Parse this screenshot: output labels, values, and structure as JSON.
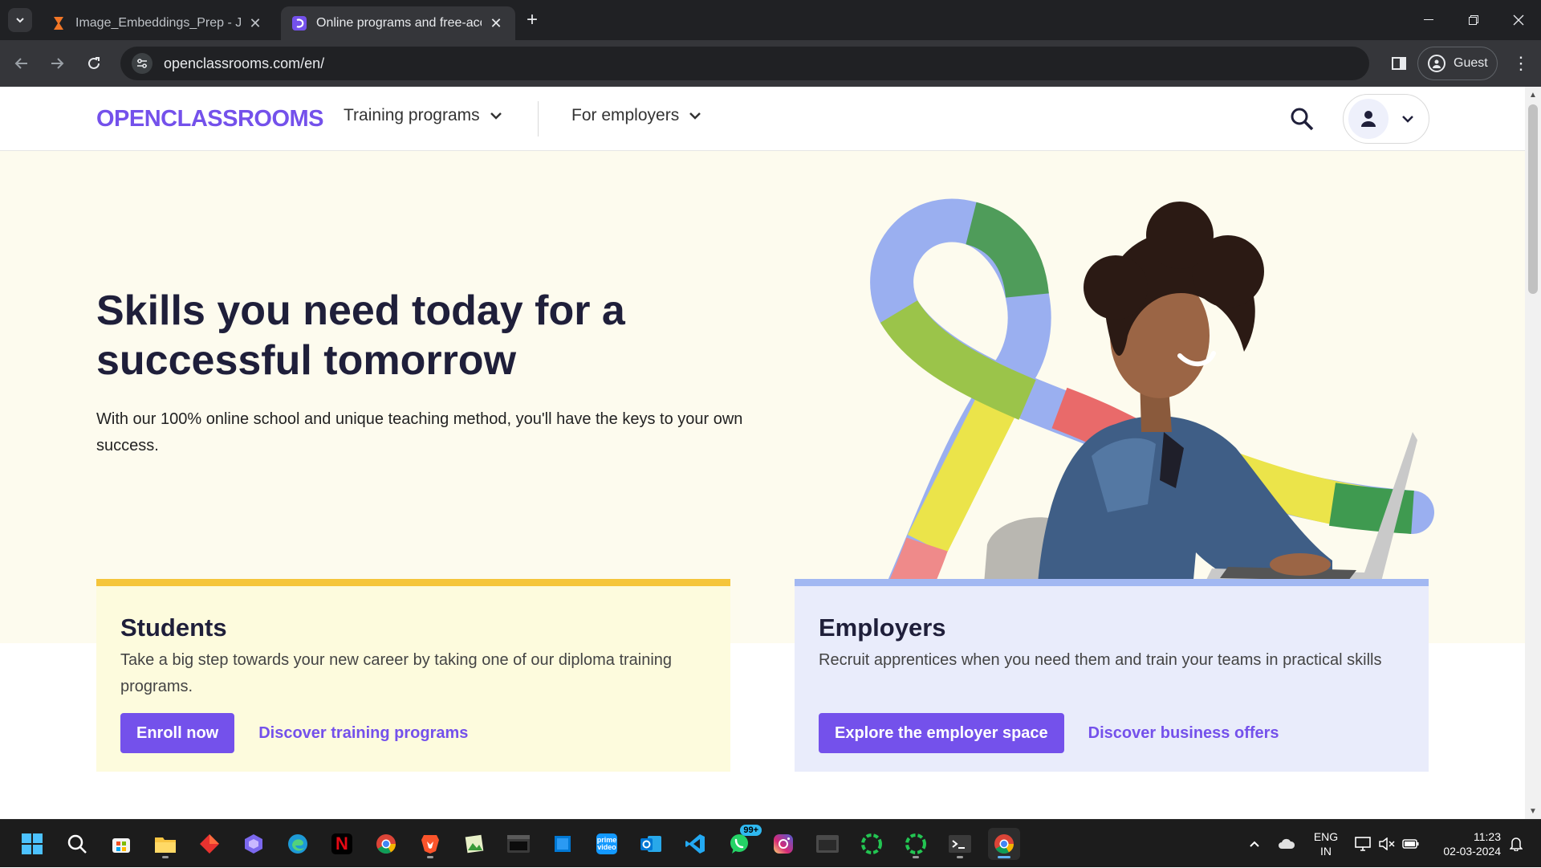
{
  "browser": {
    "tabs": [
      {
        "title": "Image_Embeddings_Prep - Jupyter",
        "active": false
      },
      {
        "title": "Online programs and free-access courses",
        "active": true
      }
    ],
    "new_tab": "+",
    "url": "openclassrooms.com/en/",
    "profile_label": "Guest"
  },
  "site": {
    "logo": "OPENCLASSROOMS",
    "nav": {
      "training": "Training programs",
      "employers": "For employers"
    },
    "hero": {
      "title": "Skills you need today for a successful tomorrow",
      "subtitle": "With our 100% online school and unique teaching method, you'll have the keys to your own success."
    },
    "students": {
      "title": "Students",
      "text": "Take a big step towards your new career by taking one of our diploma training programs.",
      "button": "Enroll now",
      "link": "Discover training programs"
    },
    "employers": {
      "title": "Employers",
      "text": "Recruit apprentices when you need them and train your teams in practical skills",
      "button": "Explore the employer space",
      "link": "Discover business offers"
    },
    "brand_color": "#7451eb"
  },
  "taskbar": {
    "badge": "99+",
    "lang_1": "ENG",
    "lang_2": "IN",
    "time": "11:23",
    "date": "02-03-2024"
  }
}
